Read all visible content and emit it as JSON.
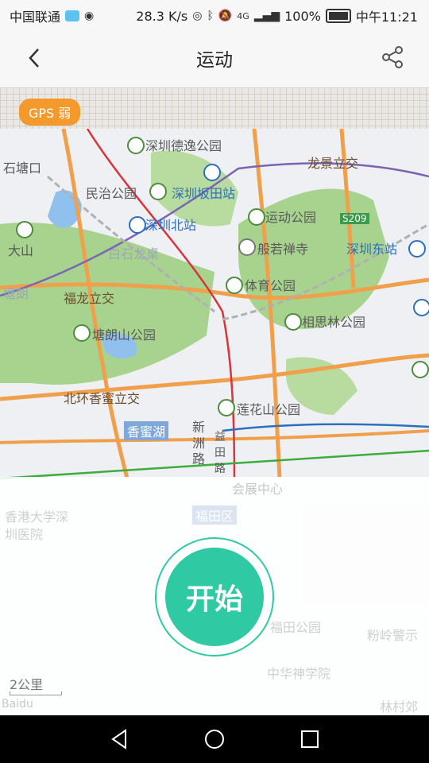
{
  "status_bar": {
    "carrier": "中国联通",
    "speed": "28.3 K/s",
    "network": "4G",
    "battery": "100%",
    "time": "中午11:21"
  },
  "header": {
    "title": "运动"
  },
  "map": {
    "gps_badge": "GPS 弱",
    "scale_label": "2公里",
    "logo_text": "Baidu",
    "labels": [
      {
        "text": "深圳德逸公园",
        "cls": "",
        "poi": "park"
      },
      {
        "text": "龙景立交",
        "cls": "brown",
        "poi": ""
      },
      {
        "text": "石塘口",
        "cls": "",
        "poi": ""
      },
      {
        "text": "民治公园",
        "cls": "",
        "poi": "park"
      },
      {
        "text": "深圳坂田站",
        "cls": "blue",
        "poi": "metro"
      },
      {
        "text": "深圳北站",
        "cls": "blue",
        "poi": "metro"
      },
      {
        "text": "运动公园",
        "cls": "",
        "poi": "park"
      },
      {
        "text": "S209",
        "cls": "",
        "poi": ""
      },
      {
        "text": "大山",
        "cls": "",
        "poi": "mountain"
      },
      {
        "text": "白石龙桌",
        "cls": "",
        "poi": ""
      },
      {
        "text": "般若禅寺",
        "cls": "",
        "poi": "temple"
      },
      {
        "text": "深圳东站",
        "cls": "blue",
        "poi": "metro"
      },
      {
        "text": "塘朗",
        "cls": "",
        "poi": ""
      },
      {
        "text": "体育公园",
        "cls": "",
        "poi": "park"
      },
      {
        "text": "福龙立交",
        "cls": "brown",
        "poi": ""
      },
      {
        "text": "相思林公园",
        "cls": "",
        "poi": "park"
      },
      {
        "text": "塘朗山公园",
        "cls": "",
        "poi": "park"
      },
      {
        "text": "北环香蜜立交",
        "cls": "brown",
        "poi": ""
      },
      {
        "text": "莲花山公园",
        "cls": "",
        "poi": "park"
      },
      {
        "text": "香蜜湖",
        "cls": "white-bg",
        "poi": ""
      },
      {
        "text": "新洲路",
        "cls": "",
        "poi": ""
      },
      {
        "text": "益田路",
        "cls": "",
        "poi": ""
      },
      {
        "text": "会展中心",
        "cls": "",
        "poi": ""
      },
      {
        "text": "福田区",
        "cls": "white-bg",
        "poi": ""
      },
      {
        "text": "香港大学深圳医院",
        "cls": "",
        "poi": ""
      },
      {
        "text": "福田公园",
        "cls": "",
        "poi": ""
      },
      {
        "text": "粉岭警示",
        "cls": "",
        "poi": ""
      },
      {
        "text": "中华神学院",
        "cls": "",
        "poi": ""
      },
      {
        "text": "林村郊",
        "cls": "",
        "poi": ""
      }
    ]
  },
  "actions": {
    "start_label": "开始"
  },
  "colors": {
    "accent": "#2fc9a3",
    "gps_badge": "#f49a2c",
    "park_green": "#9fcf86",
    "water_blue": "#8fc0ee"
  }
}
